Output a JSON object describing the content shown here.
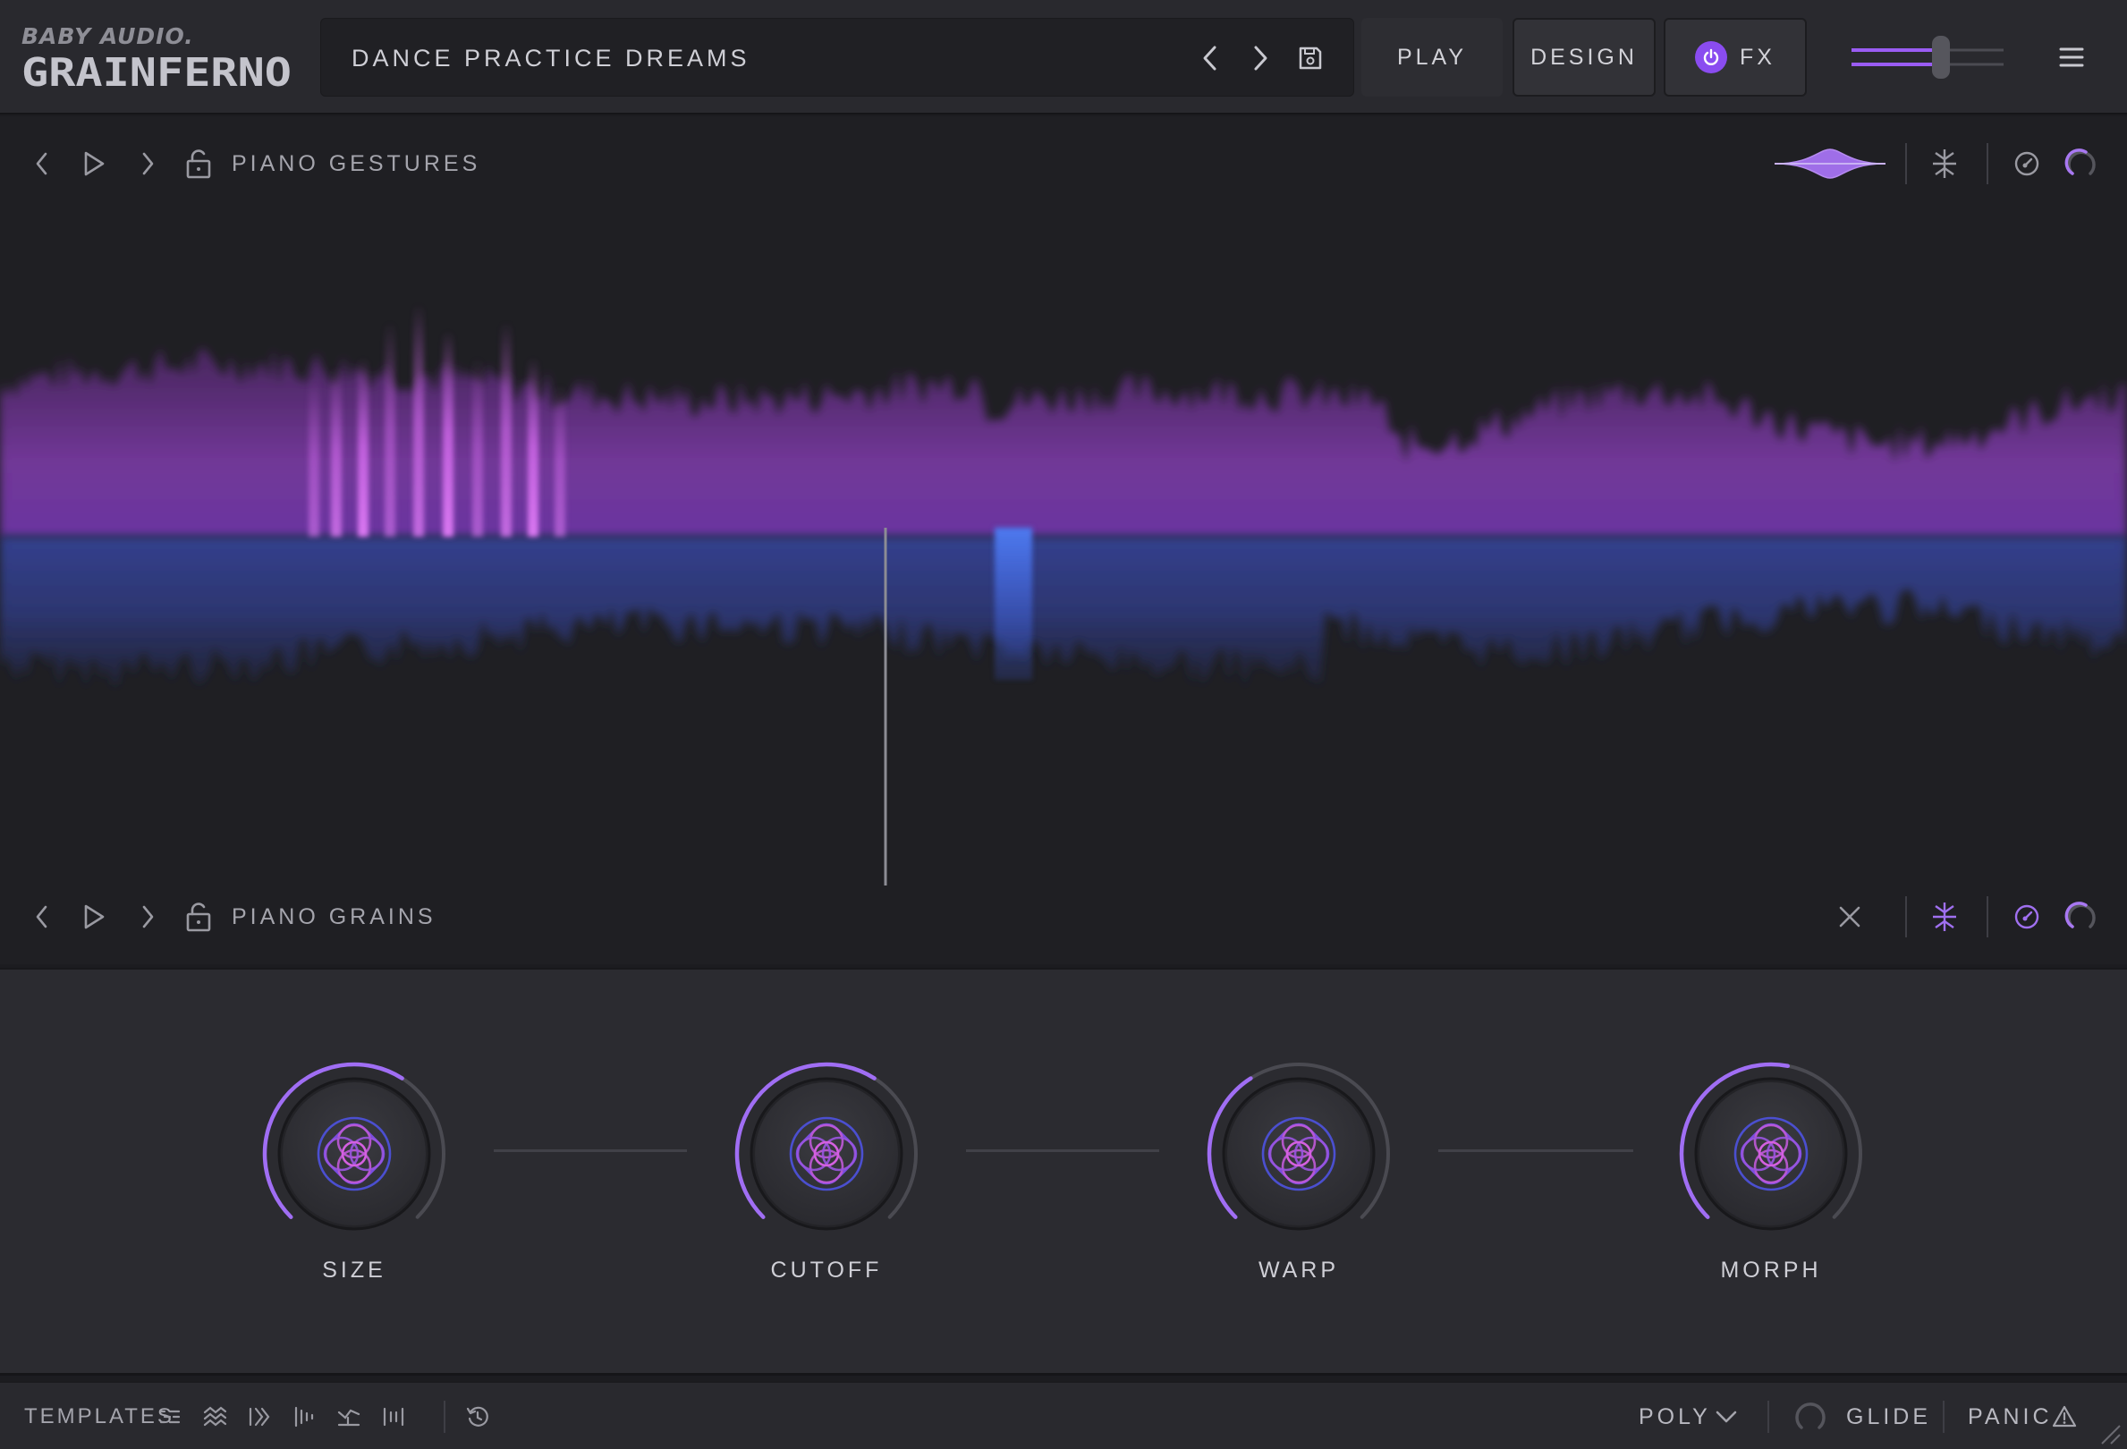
{
  "header": {
    "brand": "BABY AUDIO.",
    "product": "GRAINFERNO",
    "preset_name": "DANCE PRACTICE DREAMS",
    "play_label": "PLAY",
    "design_label": "DESIGN",
    "fx_label": "FX",
    "volume_level": 0.6
  },
  "layers": [
    {
      "name": "PIANO GESTURES"
    },
    {
      "name": "PIANO GRAINS"
    }
  ],
  "macros": [
    {
      "label": "SIZE",
      "value": 0.62
    },
    {
      "label": "CUTOFF",
      "value": 0.62
    },
    {
      "label": "WARP",
      "value": 0.38
    },
    {
      "label": "MORPH",
      "value": 0.54
    }
  ],
  "footer": {
    "templates_label": "TEMPLATES",
    "poly_label": "POLY",
    "glide_label": "GLIDE",
    "panic_label": "PANIC"
  },
  "colors": {
    "accent": "#8a4cf0",
    "magenta": "#c860e8",
    "blue": "#4a5cd8",
    "background": "#1c1c20"
  }
}
